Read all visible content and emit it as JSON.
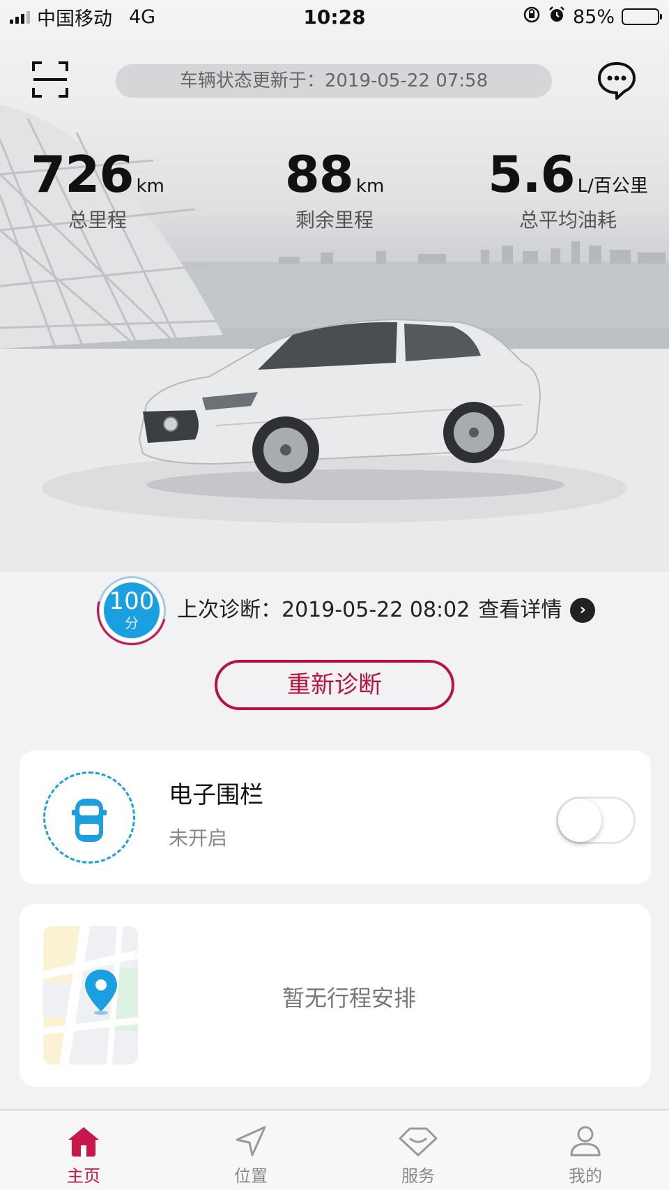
{
  "status_bar": {
    "carrier": "中国移动",
    "network": "4G",
    "time": "10:28",
    "battery": "85%",
    "battery_level": 0.85
  },
  "header": {
    "update_text": "车辆状态更新于：2019-05-22 07:58"
  },
  "stats": [
    {
      "value": "726",
      "unit": "km",
      "label": "总里程"
    },
    {
      "value": "88",
      "unit": "km",
      "label": "剩余里程"
    },
    {
      "value": "5.6",
      "unit": "L/百公里",
      "label": "总平均油耗"
    }
  ],
  "diagnosis": {
    "score": "100",
    "score_unit": "分",
    "last_text": "上次诊断：2019-05-22 08:02",
    "detail_link": "查看详情",
    "rediagnose_button": "重新诊断"
  },
  "fence": {
    "title": "电子围栏",
    "status": "未开启",
    "enabled": false
  },
  "trip": {
    "empty_text": "暂无行程安排"
  },
  "tabs": [
    {
      "label": "主页",
      "icon": "home-icon",
      "active": true
    },
    {
      "label": "位置",
      "icon": "location-arrow-icon",
      "active": false
    },
    {
      "label": "服务",
      "icon": "service-icon",
      "active": false
    },
    {
      "label": "我的",
      "icon": "profile-icon",
      "active": false
    }
  ],
  "colors": {
    "accent": "#c8174a",
    "score_blue": "#1a9fe0"
  }
}
